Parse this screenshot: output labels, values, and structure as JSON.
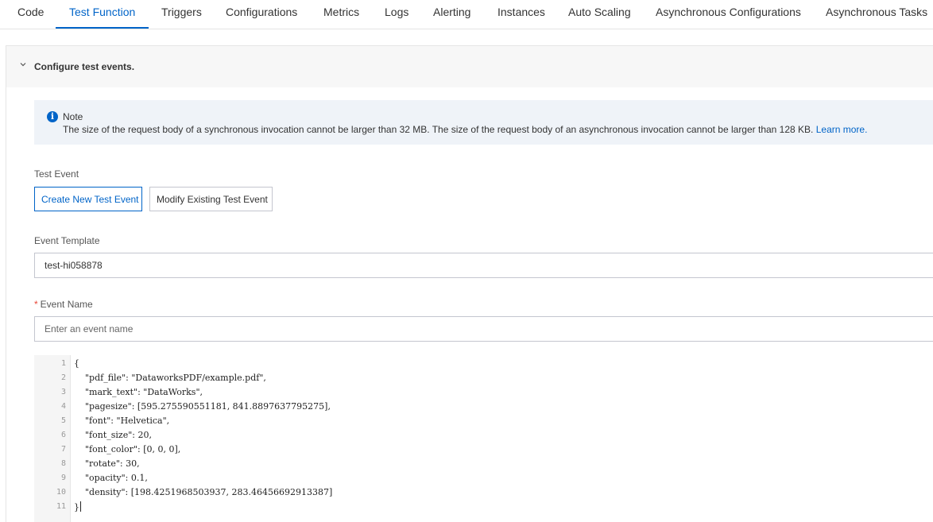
{
  "tabs": [
    {
      "label": "Code"
    },
    {
      "label": "Test Function"
    },
    {
      "label": "Triggers"
    },
    {
      "label": "Configurations"
    },
    {
      "label": "Metrics"
    },
    {
      "label": "Logs"
    },
    {
      "label": "Alerting"
    },
    {
      "label": "Instances"
    },
    {
      "label": "Auto Scaling"
    },
    {
      "label": "Asynchronous Configurations"
    },
    {
      "label": "Asynchronous Tasks"
    }
  ],
  "active_tab": "Test Function",
  "panel": {
    "title": "Configure test events.",
    "note": {
      "title": "Note",
      "text": "The size of the request body of a synchronous invocation cannot be larger than 32 MB. The size of the request body of an asynchronous invocation cannot be larger than 128 KB.",
      "link": "Learn more."
    },
    "test_event": {
      "label": "Test Event",
      "create_button": "Create New Test Event",
      "modify_button": "Modify Existing Test Event"
    },
    "event_template": {
      "label": "Event Template",
      "value": "test-hi058878"
    },
    "event_name": {
      "required_mark": "*",
      "label": "Event Name",
      "placeholder": "Enter an event name"
    },
    "editor": {
      "line_numbers": [
        "1",
        "2",
        "3",
        "4",
        "5",
        "6",
        "7",
        "8",
        "9",
        "10",
        "11"
      ],
      "lines": [
        "{",
        "    \"pdf_file\": \"DataworksPDF/example.pdf\",",
        "    \"mark_text\": \"DataWorks\",",
        "    \"pagesize\": [595.275590551181, 841.8897637795275],",
        "    \"font\": \"Helvetica\",",
        "    \"font_size\": 20,",
        "    \"font_color\": [0, 0, 0],",
        "    \"rotate\": 30,",
        "    \"opacity\": 0.1,",
        "    \"density\": [198.4251968503937, 283.46456692913387]",
        "}"
      ]
    }
  },
  "colors": {
    "accent": "#0064c8",
    "note_bg": "#eff3f8",
    "required": "#e84738"
  },
  "icons": {
    "collapse": "chevron-down-icon",
    "note": "info-icon"
  }
}
